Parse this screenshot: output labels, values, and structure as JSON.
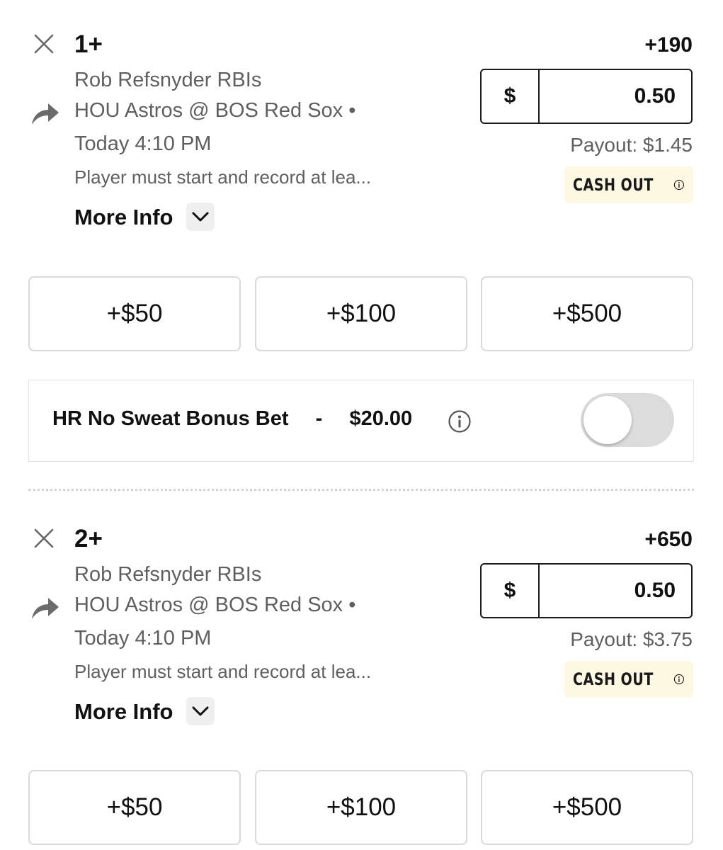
{
  "currency_symbol": "$",
  "more_info_label": "More Info",
  "cash_out_label": "CASH OUT",
  "bonus": {
    "label": "HR No Sweat Bonus Bet",
    "separator": "-",
    "amount": "$20.00",
    "enabled": false
  },
  "bets": [
    {
      "title": "1+",
      "odds": "+190",
      "market": "Rob Refsnyder RBIs",
      "matchup": "HOU Astros @ BOS Red Sox •",
      "time": "Today 4:10 PM",
      "note": "Player must start and record at lea...",
      "stake": "0.50",
      "payout": "Payout: $1.45",
      "quick_stakes": [
        "+$50",
        "+$100",
        "+$500"
      ]
    },
    {
      "title": "2+",
      "odds": "+650",
      "market": "Rob Refsnyder RBIs",
      "matchup": "HOU Astros @ BOS Red Sox •",
      "time": "Today 4:10 PM",
      "note": "Player must start and record at lea...",
      "stake": "0.50",
      "payout": "Payout: $3.75",
      "quick_stakes": [
        "+$50",
        "+$100",
        "+$500"
      ]
    }
  ]
}
